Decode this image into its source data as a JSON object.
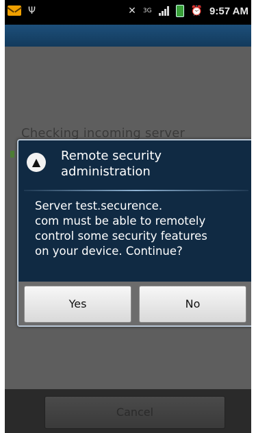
{
  "status_bar": {
    "time": "9:57 AM",
    "network_label": "3G",
    "icons": [
      "mail-icon",
      "usb-icon",
      "mute-icon",
      "network-3g-icon",
      "signal-icon",
      "battery-icon",
      "alarm-icon"
    ]
  },
  "background_screen": {
    "status_text": "Checking incoming server settings...",
    "cancel_label": "Cancel"
  },
  "dialog": {
    "icon": "warning-icon",
    "title": "Remote security administration",
    "message": "Server            test.securence.\ncom must be able to remotely\ncontrol some security features\non your device. Continue?",
    "yes_label": "Yes",
    "no_label": "No"
  },
  "colors": {
    "dialog_background": "#102a43",
    "title_bar": "#1d4f7a",
    "dim_overlay": "#5e5e5e"
  }
}
